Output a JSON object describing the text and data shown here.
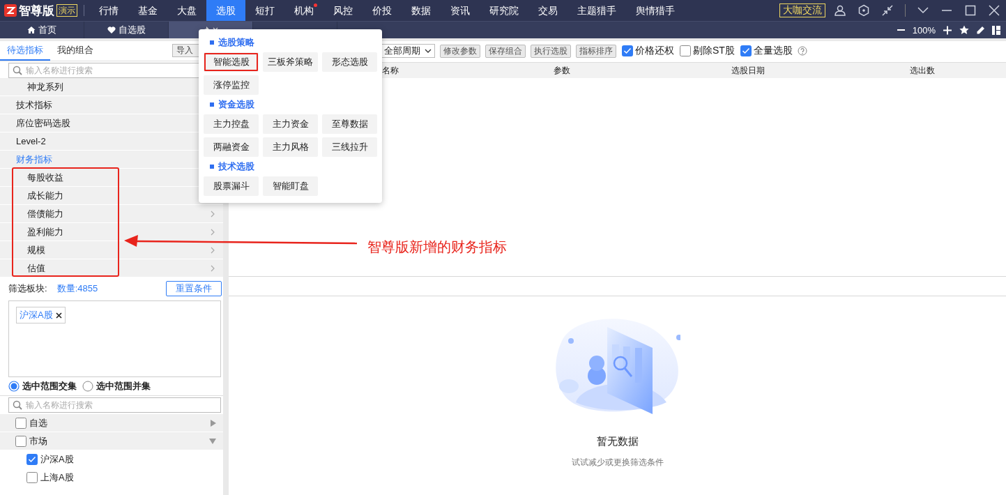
{
  "app": {
    "brand": "智尊版",
    "badge": "演示"
  },
  "nav": [
    {
      "label": "行情",
      "selected": false,
      "alert": false
    },
    {
      "label": "基金",
      "selected": false,
      "alert": false
    },
    {
      "label": "大盘",
      "selected": false,
      "alert": false
    },
    {
      "label": "选股",
      "selected": true,
      "alert": false
    },
    {
      "label": "短打",
      "selected": false,
      "alert": false
    },
    {
      "label": "机构",
      "selected": false,
      "alert": true
    },
    {
      "label": "风控",
      "selected": false,
      "alert": false
    },
    {
      "label": "价投",
      "selected": false,
      "alert": false
    },
    {
      "label": "数据",
      "selected": false,
      "alert": false
    },
    {
      "label": "资讯",
      "selected": false,
      "alert": false
    },
    {
      "label": "研究院",
      "selected": false,
      "alert": false
    },
    {
      "label": "交易",
      "selected": false,
      "alert": false
    },
    {
      "label": "主题猎手",
      "selected": false,
      "alert": false
    },
    {
      "label": "舆情猎手",
      "selected": false,
      "alert": false
    }
  ],
  "community_button": "大咖交流",
  "tabs": [
    {
      "label": "首页",
      "kind": "home",
      "selected": false
    },
    {
      "label": "自选股",
      "kind": "heart",
      "selected": false
    },
    {
      "kind": "closable",
      "selected": true
    },
    {
      "kind": "plain",
      "selected": false
    }
  ],
  "zoom": "100%",
  "left_panel": {
    "tabs": [
      {
        "label": "待选指标",
        "selected": true
      },
      {
        "label": "我的组合",
        "selected": false
      }
    ],
    "import_button": "导入",
    "search_placeholder": "输入名称进行搜索",
    "indicators": [
      {
        "children": [
          {
            "label": "神龙系列"
          }
        ]
      },
      {
        "label": "技术指标",
        "selected": false
      },
      {
        "label": "席位密码选股",
        "selected": false
      },
      {
        "label": "Level-2",
        "selected": false
      },
      {
        "label": "财务指标",
        "selected": true,
        "children": [
          {
            "label": "每股收益"
          },
          {
            "label": "成长能力"
          },
          {
            "label": "偿债能力"
          },
          {
            "label": "盈利能力"
          },
          {
            "label": "规模"
          },
          {
            "label": "估值"
          }
        ]
      }
    ],
    "filter_label": "筛选板块:",
    "count": "数量:4855",
    "reset_button": "重置条件",
    "tags": [
      "沪深A股"
    ],
    "modes": [
      {
        "label": "选中范围交集",
        "selected": true
      },
      {
        "label": "选中范围并集",
        "selected": false
      }
    ],
    "sector_search_placeholder": "输入名称进行搜索",
    "sectors": [
      {
        "label": "自选",
        "checked": false,
        "expanded": false
      },
      {
        "label": "市场",
        "checked": false,
        "expanded": true,
        "children": [
          {
            "label": "沪深A股",
            "checked": true
          },
          {
            "label": "上海A股",
            "checked": false
          }
        ]
      }
    ]
  },
  "toolbar": {
    "period": "全部周期",
    "buttons": [
      "修改参数",
      "保存组合",
      "执行选股",
      "指标排序"
    ],
    "options": [
      {
        "label": "价格还权",
        "checked": true
      },
      {
        "label": "剔除ST股",
        "checked": false
      },
      {
        "label": "全量选股",
        "checked": true
      }
    ]
  },
  "table": {
    "columns": [
      "名称",
      "参数",
      "选股日期",
      "选出数"
    ]
  },
  "empty": {
    "title": "暂无数据",
    "hint": "试试减少或更换筛选条件"
  },
  "menu": {
    "sections": [
      {
        "title": "选股策略",
        "items": [
          {
            "label": "智能选股",
            "highlighted": true
          },
          {
            "label": "三板斧策略",
            "highlighted": false
          },
          {
            "label": "形态选股",
            "highlighted": false
          },
          {
            "label": "涨停监控",
            "highlighted": false
          }
        ]
      },
      {
        "title": "资金选股",
        "items": [
          {
            "label": "主力控盘",
            "highlighted": false
          },
          {
            "label": "主力资金",
            "highlighted": false
          },
          {
            "label": "至尊数据",
            "highlighted": false
          },
          {
            "label": "两融资金",
            "highlighted": false
          },
          {
            "label": "主力风格",
            "highlighted": false
          },
          {
            "label": "三线拉升",
            "highlighted": false
          }
        ]
      },
      {
        "title": "技术选股",
        "items": [
          {
            "label": "股票漏斗",
            "highlighted": false
          },
          {
            "label": "智能盯盘",
            "highlighted": false
          }
        ]
      }
    ]
  },
  "annotation": {
    "text": "智尊版新增的财务指标"
  }
}
